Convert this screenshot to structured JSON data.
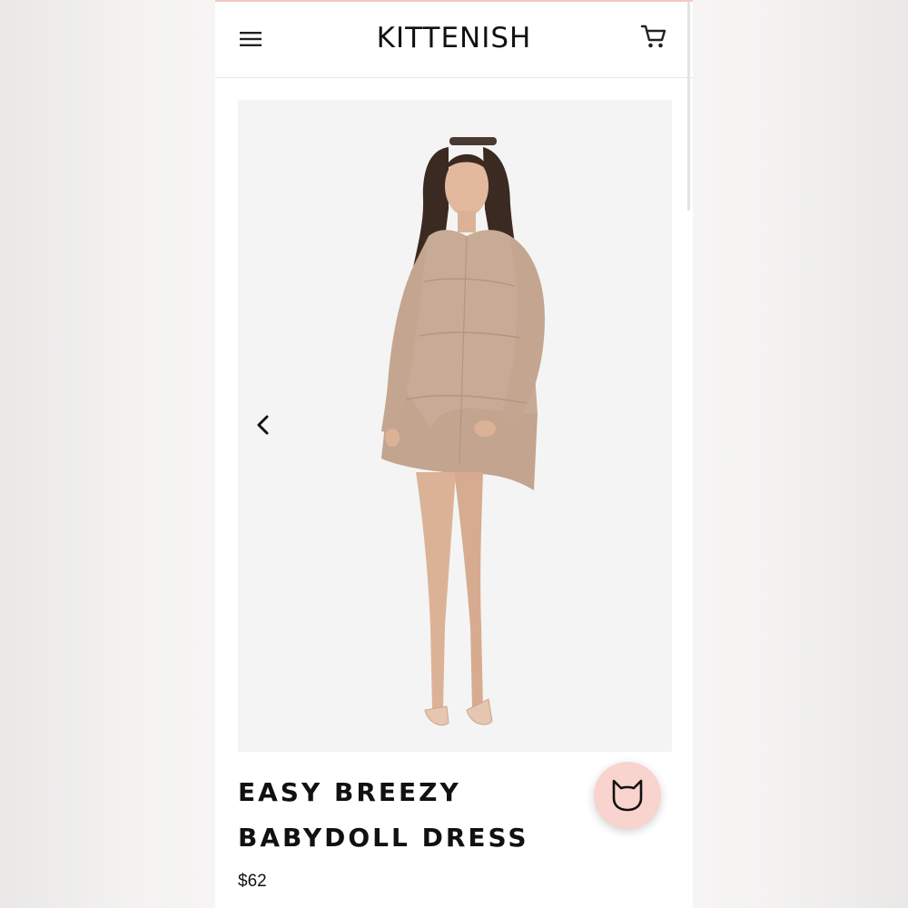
{
  "header": {
    "brand": "KITTENISH",
    "menu_icon": "hamburger-menu-icon",
    "cart_icon": "shopping-cart-icon"
  },
  "gallery": {
    "image_alt": "Model wearing taupe babydoll shirt dress",
    "prev_icon": "chevron-left-icon",
    "next_icon": "chevron-right-icon"
  },
  "product": {
    "title_line1": "EASY BREEZY",
    "title_line2": "BABYDOLL DRESS",
    "price": "$62"
  },
  "chat": {
    "icon": "cat-face-icon"
  },
  "colors": {
    "accent_pink": "#f9d3cd",
    "text": "#111111",
    "dress": "#c8ab96"
  }
}
